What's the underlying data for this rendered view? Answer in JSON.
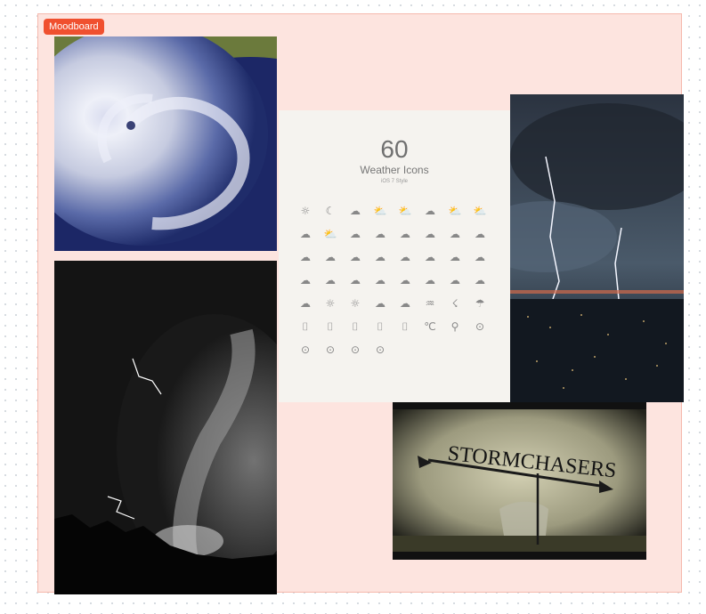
{
  "board": {
    "label": "Moodboard",
    "accent": "#f0502f",
    "background": "#fde4df"
  },
  "sheet": {
    "count": "60",
    "title": "Weather Icons",
    "subtitle": "iOS 7 Style",
    "icons": [
      "☼",
      "☾",
      "☁",
      "⛅",
      "⛅",
      "☁",
      "⛅",
      "⛅",
      "☁",
      "⛅",
      "☁",
      "☁",
      "☁",
      "☁",
      "☁",
      "☁",
      "☁",
      "☁",
      "☁",
      "☁",
      "☁",
      "☁",
      "☁",
      "☁",
      "☁",
      "☁",
      "☁",
      "☁",
      "☁",
      "☁",
      "☁",
      "☁",
      "☁",
      "☼",
      "☼",
      "☁",
      "☁",
      "♒",
      "☇",
      "☂",
      "⌷",
      "⌷",
      "⌷",
      "⌷",
      "⌷",
      "℃",
      "⚲",
      "⊙",
      "⊙",
      "⊙",
      "⊙",
      "⊙"
    ]
  },
  "images": {
    "hurricane": "hurricane satellite image",
    "tornado_bw": "black and white tornado lightning photo",
    "lightning_city": "lightning over city photo",
    "stormchasers": "STORMCHASERS"
  }
}
